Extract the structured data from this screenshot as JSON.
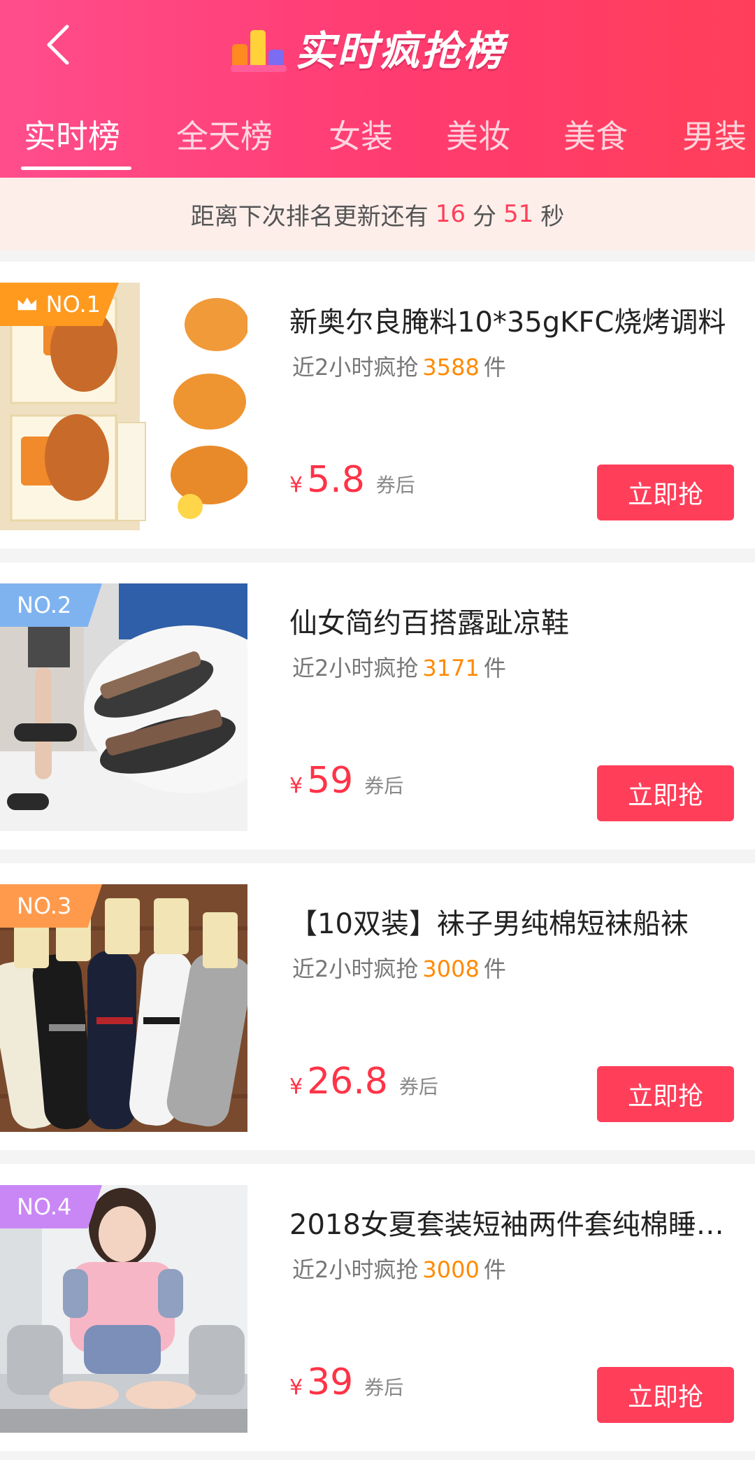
{
  "header": {
    "title": "实时疯抢榜",
    "back_icon": "chevron-left-icon",
    "logo_icon": "bar-chart-logo",
    "tabs": [
      {
        "label": "实时榜",
        "active": true
      },
      {
        "label": "全天榜",
        "active": false
      },
      {
        "label": "女装",
        "active": false
      },
      {
        "label": "美妆",
        "active": false
      },
      {
        "label": "美食",
        "active": false
      },
      {
        "label": "男装",
        "active": false
      }
    ]
  },
  "countdown": {
    "prefix": "距离下次排名更新还有",
    "minutes": "16",
    "minutes_unit": "分",
    "seconds": "51",
    "seconds_unit": "秒"
  },
  "products": [
    {
      "rank": "NO.1",
      "title": "新奥尔良腌料10*35gKFC烧烤调料",
      "sales_prefix": "近2小时疯抢",
      "sales_count": "3588",
      "sales_unit": "件",
      "currency": "¥",
      "price": "5.8",
      "price_note": "券后",
      "button": "立即抢"
    },
    {
      "rank": "NO.2",
      "title": "仙女简约百搭露趾凉鞋",
      "sales_prefix": "近2小时疯抢",
      "sales_count": "3171",
      "sales_unit": "件",
      "currency": "¥",
      "price": "59",
      "price_note": "券后",
      "button": "立即抢"
    },
    {
      "rank": "NO.3",
      "title": "【10双装】袜子男纯棉短袜船袜",
      "sales_prefix": "近2小时疯抢",
      "sales_count": "3008",
      "sales_unit": "件",
      "currency": "¥",
      "price": "26.8",
      "price_note": "券后",
      "button": "立即抢"
    },
    {
      "rank": "NO.4",
      "title": "2018女夏套装短袖两件套纯棉睡…",
      "sales_prefix": "近2小时疯抢",
      "sales_count": "3000",
      "sales_unit": "件",
      "currency": "¥",
      "price": "39",
      "price_note": "券后",
      "button": "立即抢"
    }
  ],
  "colors": {
    "header_start": "#ff4d8c",
    "header_end": "#ff3f5a",
    "accent": "#ff3f5a",
    "sales_count": "#ff8a00"
  }
}
